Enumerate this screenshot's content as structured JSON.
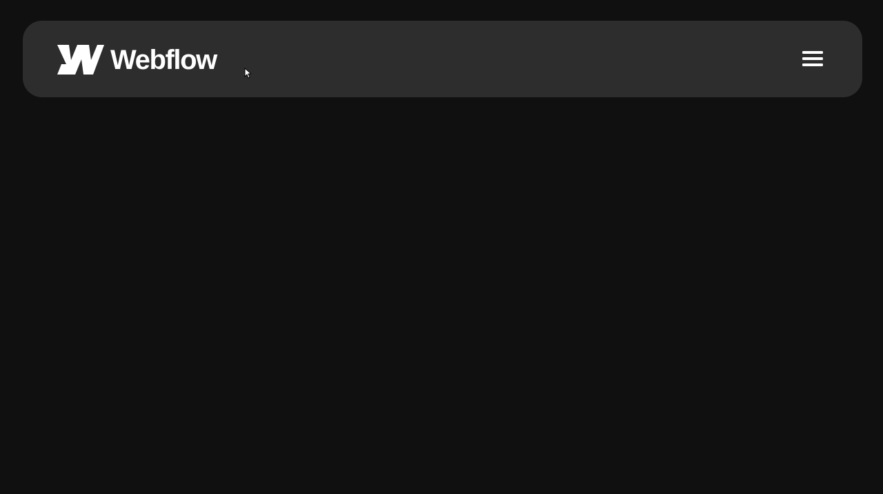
{
  "brand": {
    "name": "Webflow",
    "logo_icon": "webflow-w-logo"
  },
  "nav": {
    "menu_icon": "hamburger-menu-icon",
    "menu_aria_label": ""
  },
  "colors": {
    "page_background": "#101010",
    "navbar_background": "#2d2d2d",
    "foreground": "#ffffff"
  }
}
